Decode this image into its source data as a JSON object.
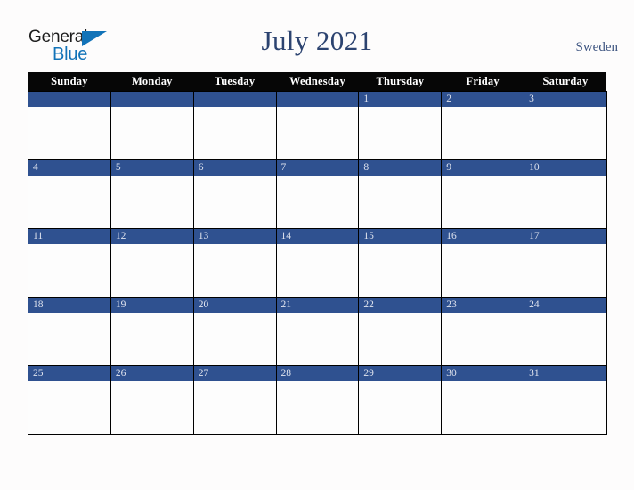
{
  "brand": {
    "name_top": "General",
    "name_bottom": "Blue",
    "flag_icon": "triangle-flag-icon",
    "colors": {
      "text_dark": "#1c1c1c",
      "blue": "#1273b8"
    }
  },
  "header": {
    "title": "July 2021",
    "country": "Sweden",
    "title_color": "#2c4370",
    "country_color": "#3d5480"
  },
  "calendar": {
    "month": "July",
    "year": "2021",
    "weekday_headers": [
      "Sunday",
      "Monday",
      "Tuesday",
      "Wednesday",
      "Thursday",
      "Friday",
      "Saturday"
    ],
    "header_bg": "#060606",
    "header_text_color": "#ffffff",
    "daybar_bg": "#2f5190",
    "daybar_text_color": "#dfe3ee",
    "cell_bg": "#fdfdfd",
    "border_color": "#000000",
    "weeks": [
      [
        "",
        "",
        "",
        "",
        "1",
        "2",
        "3"
      ],
      [
        "4",
        "5",
        "6",
        "7",
        "8",
        "9",
        "10"
      ],
      [
        "11",
        "12",
        "13",
        "14",
        "15",
        "16",
        "17"
      ],
      [
        "18",
        "19",
        "20",
        "21",
        "22",
        "23",
        "24"
      ],
      [
        "25",
        "26",
        "27",
        "28",
        "29",
        "30",
        "31"
      ]
    ]
  },
  "page": {
    "background": "#fdfcfc"
  }
}
